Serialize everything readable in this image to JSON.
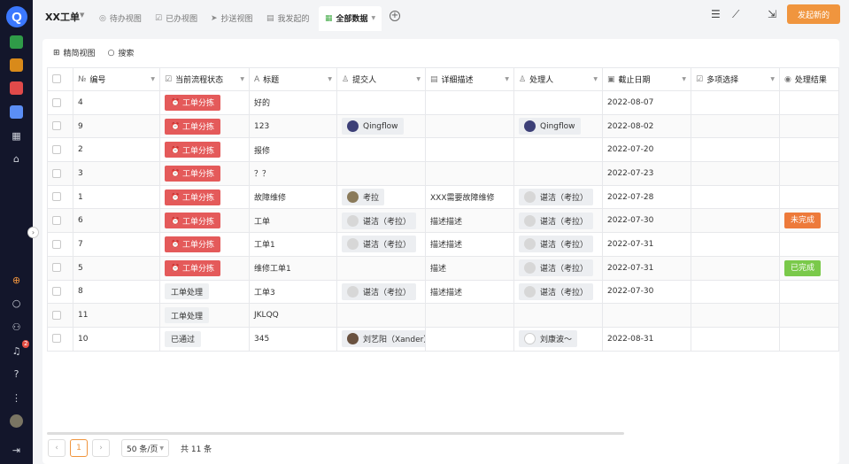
{
  "sidebar": {
    "logo": "Q",
    "badge_count": "2",
    "icons": [
      "app-green-icon",
      "app-orange-icon",
      "app-red-icon",
      "app-blue-icon",
      "grid-icon",
      "home-icon",
      "add-circle-icon",
      "search-icon",
      "users-icon",
      "bell-icon",
      "help-icon",
      "apps-icon",
      "avatar",
      "collapse-icon"
    ]
  },
  "header": {
    "title": "XX工单",
    "tabs": [
      {
        "label": "待办视图",
        "icon": "check-circle-icon"
      },
      {
        "label": "已办视图",
        "icon": "checkbox-icon"
      },
      {
        "label": "抄送视图",
        "icon": "send-icon"
      },
      {
        "label": "我发起的",
        "icon": "form-icon"
      },
      {
        "label": "全部数据",
        "icon": "table-icon",
        "active": true
      }
    ],
    "new_button": "发起新的"
  },
  "toolbar": {
    "compact_view": "精简视图",
    "search": "搜索"
  },
  "table": {
    "columns": [
      "编号",
      "当前流程状态",
      "标题",
      "提交人",
      "详细描述",
      "处理人",
      "截止日期",
      "多项选择",
      "处理结果"
    ],
    "rows": [
      {
        "id": "4",
        "status": "工单分拣",
        "status_type": "red",
        "title": "好的",
        "submitter": "",
        "submitter_av": "",
        "desc": "",
        "handler": "",
        "handler_av": "",
        "due": "2022-08-07",
        "multi": "",
        "result": "",
        "result_color": ""
      },
      {
        "id": "9",
        "status": "工单分拣",
        "status_type": "red",
        "title": "123",
        "submitter": "Qingflow",
        "submitter_av": "q",
        "desc": "",
        "handler": "Qingflow",
        "handler_av": "q",
        "due": "2022-08-02",
        "multi": "",
        "result": "",
        "result_color": ""
      },
      {
        "id": "2",
        "status": "工单分拣",
        "status_type": "red",
        "title": "报修",
        "submitter": "",
        "submitter_av": "",
        "desc": "",
        "handler": "",
        "handler_av": "",
        "due": "2022-07-20",
        "multi": "",
        "result": "",
        "result_color": ""
      },
      {
        "id": "3",
        "status": "工单分拣",
        "status_type": "red",
        "title": "？？",
        "submitter": "",
        "submitter_av": "",
        "desc": "",
        "handler": "",
        "handler_av": "",
        "due": "2022-07-23",
        "multi": "",
        "result": "",
        "result_color": ""
      },
      {
        "id": "1",
        "status": "工单分拣",
        "status_type": "red",
        "title": "故障维修",
        "submitter": "考拉",
        "submitter_av": "k",
        "desc": "XXX需要故障维修",
        "handler": "谌洁（考拉）",
        "handler_av": "n",
        "due": "2022-07-28",
        "multi": "",
        "result": "",
        "result_color": ""
      },
      {
        "id": "6",
        "status": "工单分拣",
        "status_type": "red",
        "title": "工单",
        "submitter": "谌洁（考拉）",
        "submitter_av": "n",
        "desc": "描述描述",
        "handler": "谌洁（考拉）",
        "handler_av": "n",
        "due": "2022-07-30",
        "multi": "",
        "result": "未完成",
        "result_color": "#ed7a3a"
      },
      {
        "id": "7",
        "status": "工单分拣",
        "status_type": "red",
        "title": "工单1",
        "submitter": "谌洁（考拉）",
        "submitter_av": "n",
        "desc": "描述描述",
        "handler": "谌洁（考拉）",
        "handler_av": "n",
        "due": "2022-07-31",
        "multi": "",
        "result": "",
        "result_color": ""
      },
      {
        "id": "5",
        "status": "工单分拣",
        "status_type": "red",
        "title": "维修工单1",
        "submitter": "",
        "submitter_av": "",
        "desc": "描述",
        "handler": "谌洁（考拉）",
        "handler_av": "n",
        "due": "2022-07-31",
        "multi": "",
        "result": "已完成",
        "result_color": "#7ac94a"
      },
      {
        "id": "8",
        "status": "工单处理",
        "status_type": "grey",
        "title": "工单3",
        "submitter": "谌洁（考拉）",
        "submitter_av": "n",
        "desc": "描述描述",
        "handler": "谌洁（考拉）",
        "handler_av": "n",
        "due": "2022-07-30",
        "multi": "",
        "result": "",
        "result_color": ""
      },
      {
        "id": "11",
        "status": "工单处理",
        "status_type": "grey",
        "title": "JKLQQ",
        "submitter": "",
        "submitter_av": "",
        "desc": "",
        "handler": "",
        "handler_av": "",
        "due": "",
        "multi": "",
        "result": "",
        "result_color": ""
      },
      {
        "id": "10",
        "status": "已通过",
        "status_type": "grey",
        "title": "345",
        "submitter": "刘艺阳（Xander）",
        "submitter_av": "l",
        "desc": "",
        "handler": "刘康波～",
        "handler_av": "lk",
        "due": "2022-08-31",
        "multi": "",
        "result": "",
        "result_color": ""
      }
    ]
  },
  "pagination": {
    "current": "1",
    "page_size": "50 条/页",
    "total": "共 11 条"
  },
  "colors": {
    "accent": "#f0953e",
    "status_red": "#e45a5a",
    "sidebar_bg": "#13162b"
  }
}
